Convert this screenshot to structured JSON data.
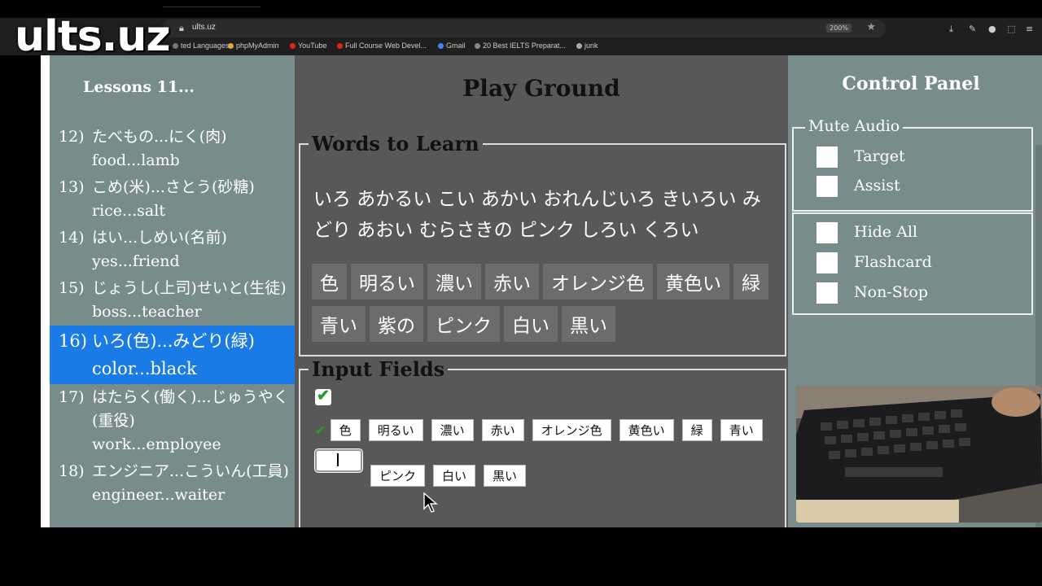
{
  "logo": "ults.uz",
  "browser": {
    "url": "ults.uz",
    "zoom": "200%",
    "bookmarks": [
      {
        "label": "ted Languages",
        "color": "#777"
      },
      {
        "label": "phpMyAdmin",
        "color": "#e8a23a"
      },
      {
        "label": "YouTube",
        "color": "#e62117"
      },
      {
        "label": "Full Course Web Devel...",
        "color": "#e62117"
      },
      {
        "label": "Gmail",
        "color": "#4285f4"
      },
      {
        "label": "20 Best IELTS Preparat...",
        "color": "#888"
      },
      {
        "label": "junk",
        "color": "#aaa"
      }
    ]
  },
  "lessons": {
    "title": "Lessons 11...",
    "items": [
      {
        "num": "12)",
        "jp": "たべもの...にく(肉)",
        "en": "food...lamb"
      },
      {
        "num": "13)",
        "jp": "こめ(米)...さとう(砂糖)",
        "en": "rice...salt"
      },
      {
        "num": "14)",
        "jp": "はい...しめい(名前)",
        "en": "yes...friend"
      },
      {
        "num": "15)",
        "jp": "じょうし(上司)せいと(生徒)",
        "en": "boss...teacher"
      },
      {
        "num": "16)",
        "jp": "いろ(色)...みどり(緑)",
        "en": "color...black",
        "active": true
      },
      {
        "num": "17)",
        "jp": "はたらく(働く)...じゅうやく(重役)",
        "en": "work...employee"
      },
      {
        "num": "18)",
        "jp": "エンジニア...こういん(工員)",
        "en": "engineer...waiter"
      }
    ]
  },
  "playground": {
    "title": "Play Ground",
    "words_legend": "Words to Learn",
    "hiragana": "いろ あかるい こい あかい おれんじいろ きいろい みどり あおい むらさきの ピンク しろい くろい",
    "kanji": [
      "色",
      "明るい",
      "濃い",
      "赤い",
      "オレンジ色",
      "黄色い",
      "緑",
      "青い",
      "紫の",
      "ピンク",
      "白い",
      "黒い"
    ],
    "input_legend": "Input Fields",
    "inputs_before": [
      "色",
      "明るい",
      "濃い",
      "赤い",
      "オレンジ色",
      "黄色い",
      "緑",
      "青い"
    ],
    "inputs_after": [
      "ピンク",
      "白い",
      "黒い"
    ]
  },
  "control_panel": {
    "title": "Control Panel",
    "mute_legend": "Mute Audio",
    "mute_options": [
      "Target",
      "Assist"
    ],
    "options": [
      "Hide All",
      "Flashcard",
      "Non-Stop"
    ]
  },
  "colors": {
    "sidebar": "#798c8c",
    "middle": "#585858",
    "active": "#1a7be6",
    "check": "#2a9a2a"
  }
}
